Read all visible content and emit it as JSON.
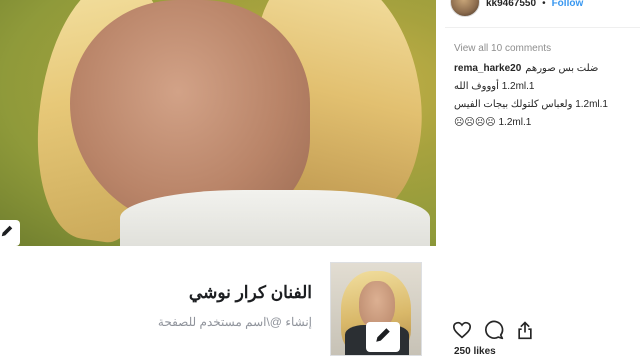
{
  "post": {
    "header": {
      "username": "kk9467550",
      "separator": "•",
      "follow_label": "Follow"
    },
    "view_all_comments": "View all 10 comments",
    "comments": [
      {
        "user": "rema_harke20",
        "text": "ضلت بس صورهم"
      },
      {
        "user": "",
        "text": "1.2ml.1 أوووف الله"
      },
      {
        "user": "",
        "text": "1.2ml.1 ولعباس كلتولك بيجات الفيس"
      },
      {
        "user": "",
        "text": "1.2ml.1 ☹☹☹☹"
      }
    ],
    "actions": [
      "heart-icon",
      "comment-icon",
      "share-icon"
    ],
    "likes": "250 likes"
  },
  "page_card": {
    "name": "الفنان كرار نوشي",
    "handle": "إنشاء @\\اسم مستخدم للصفحة"
  },
  "colors": {
    "link_blue": "#3897f0",
    "muted_gray": "#8e8e8e",
    "text_dark": "#262626"
  }
}
